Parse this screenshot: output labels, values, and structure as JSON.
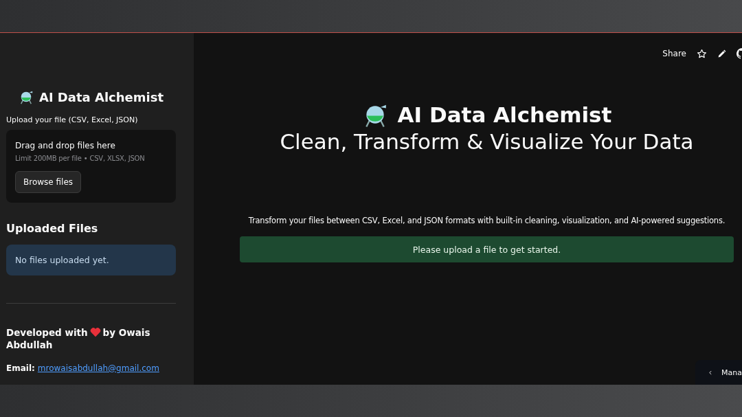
{
  "sidebar": {
    "title": "AI Data Alchemist",
    "upload_label": "Upload your file (CSV, Excel, JSON)",
    "dropzone": {
      "title": "Drag and drop files here",
      "hint": "Limit 200MB per file • CSV, XLSX, JSON",
      "button": "Browse files"
    },
    "uploaded_heading": "Uploaded Files",
    "uploaded_info": "No files uploaded yet.",
    "credit_before": "Developed with",
    "credit_after": "by Owais",
    "credit_last": "Abdullah",
    "email_label": "Email:",
    "email": "mrowaisabdullah@gmail.com"
  },
  "toolbar": {
    "share": "Share"
  },
  "main": {
    "title": "AI Data Alchemist",
    "subtitle": "Clean, Transform & Visualize Your Data",
    "description": "Transform your files between CSV, Excel, and JSON formats with built-in cleaning, visualization, and AI-powered suggestions.",
    "notice": "Please upload a file to get started."
  },
  "manage_button": "Mana"
}
